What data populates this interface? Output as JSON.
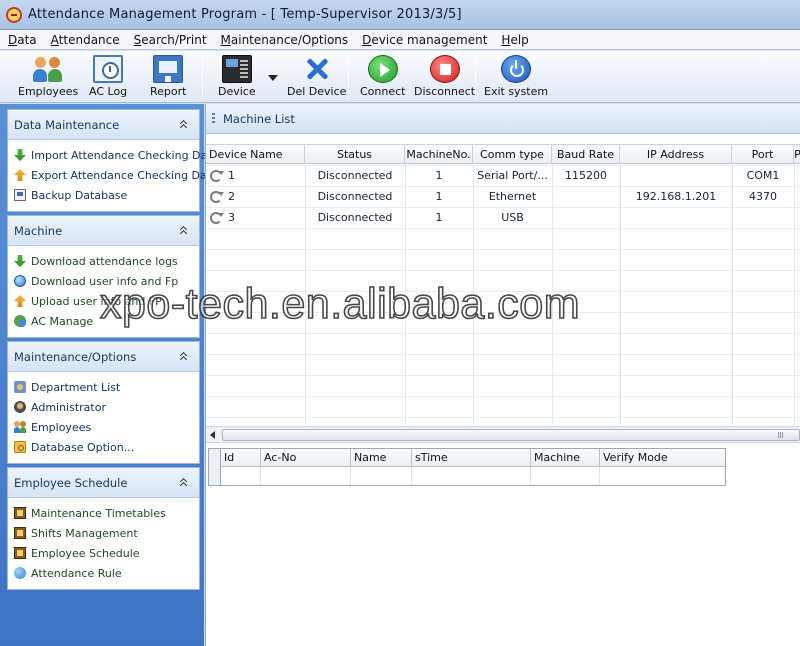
{
  "window": {
    "title": "Attendance Management Program - [ Temp-Supervisor 2013/3/5]"
  },
  "menu": [
    "Data",
    "Attendance",
    "Search/Print",
    "Maintenance/Options",
    "Device management",
    "Help"
  ],
  "toolbar": {
    "employees": "Employees",
    "aclog": "AC Log",
    "report": "Report",
    "device": "Device",
    "del_device": "Del Device",
    "connect": "Connect",
    "disconnect": "Disconnect",
    "exit": "Exit system"
  },
  "sidebar": {
    "panels": [
      {
        "title": "Data Maintenance",
        "items": [
          "Import Attendance Checking Data",
          "Export Attendance Checking Data",
          "Backup Database"
        ]
      },
      {
        "title": "Machine",
        "items": [
          "Download attendance logs",
          "Download user info and Fp",
          "Upload user info and FP",
          "AC Manage"
        ]
      },
      {
        "title": "Maintenance/Options",
        "items": [
          "Department List",
          "Administrator",
          "Employees",
          "Database Option..."
        ]
      },
      {
        "title": "Employee Schedule",
        "items": [
          "Maintenance Timetables",
          "Shifts Management",
          "Employee Schedule",
          "Attendance Rule"
        ]
      }
    ]
  },
  "machine_list": {
    "title": "Machine List",
    "columns": [
      "Device Name",
      "Status",
      "MachineNo.",
      "Comm type",
      "Baud Rate",
      "IP Address",
      "Port",
      "P"
    ],
    "rows": [
      {
        "name": "1",
        "status": "Disconnected",
        "machine_no": "1",
        "comm_type": "Serial Port/...",
        "baud_rate": "115200",
        "ip": "",
        "port": "COM1"
      },
      {
        "name": "2",
        "status": "Disconnected",
        "machine_no": "1",
        "comm_type": "Ethernet",
        "baud_rate": "",
        "ip": "192.168.1.201",
        "port": "4370"
      },
      {
        "name": "3",
        "status": "Disconnected",
        "machine_no": "1",
        "comm_type": "USB",
        "baud_rate": "",
        "ip": "",
        "port": ""
      }
    ]
  },
  "log_grid": {
    "columns": [
      "Id",
      "Ac-No",
      "Name",
      "sTime",
      "Machine",
      "Verify Mode"
    ]
  },
  "watermark": "xpo-tech.en.alibaba.com"
}
